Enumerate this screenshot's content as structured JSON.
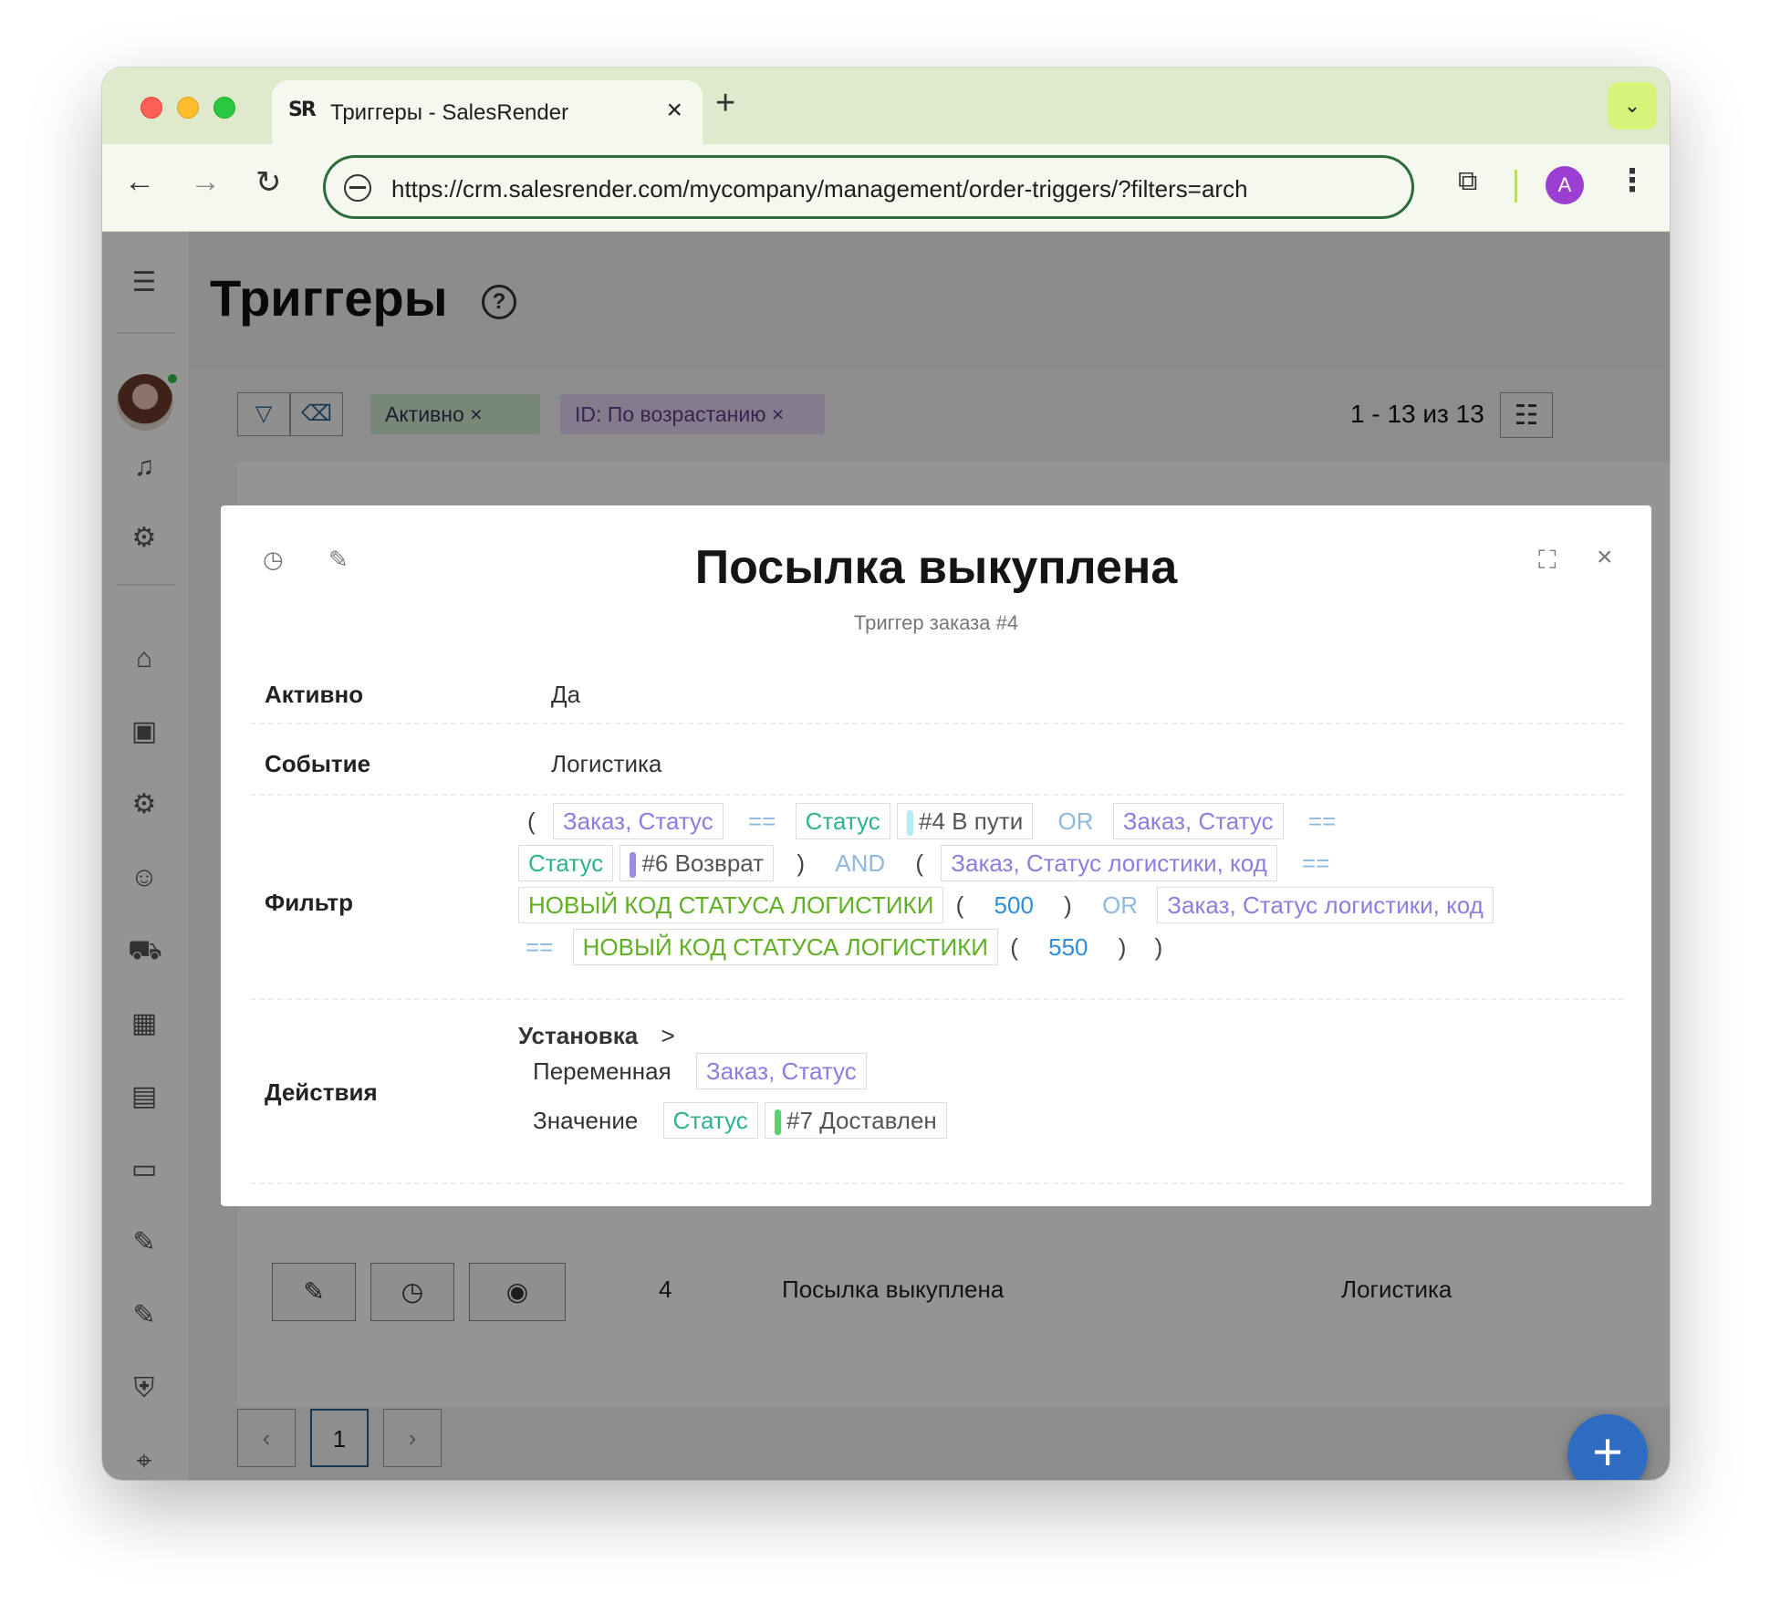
{
  "browser": {
    "tab_title": "Триггеры - SalesRender",
    "tab_logo": "SR",
    "url": "https://crm.salesrender.com/mycompany/management/order-triggers/?filters=arch",
    "avatar_letter": "A"
  },
  "page": {
    "title": "Триггеры",
    "filter_chips": [
      "Активно ×",
      "ID: По возрастанию ×"
    ],
    "count": "1 - 13 из 13",
    "row": {
      "id": "4",
      "name": "Посылка выкуплена",
      "event": "Логистика"
    },
    "pagination": {
      "current": "1"
    }
  },
  "modal": {
    "title": "Посылка выкуплена",
    "subtitle": "Триггер заказа #4",
    "active_label": "Активно",
    "active_value": "Да",
    "event_label": "Событие",
    "event_value": "Логистика",
    "filter_label": "Фильтр",
    "filter": {
      "line1": {
        "p1": "(",
        "t1": "Заказ, Статус",
        "op1": "==",
        "t2": "Статус",
        "t2b": "#4 В пути",
        "op2": "OR",
        "t3": "Заказ, Статус",
        "op3": "=="
      },
      "line2": {
        "t1": "Статус",
        "t1b": "#6 Возврат",
        "p1": ")",
        "op1": "AND",
        "p2": "(",
        "t2": "Заказ, Статус логистики, код",
        "op2": "=="
      },
      "line3": {
        "t1": "НОВЫЙ КОД СТАТУСА ЛОГИСТИКИ",
        "p1": "(",
        "n1": "500",
        "p2": ")",
        "op1": "OR",
        "t2": "Заказ, Статус логистики, код"
      },
      "line4": {
        "op1": "==",
        "t1": "НОВЫЙ КОД СТАТУСА ЛОГИСТИКИ",
        "p1": "(",
        "n1": "550",
        "p2": ")",
        "p3": ")"
      }
    },
    "actions_label": "Действия",
    "action": {
      "type": "Установка",
      "variable_label": "Переменная",
      "variable_value": "Заказ, Статус",
      "value_label": "Значение",
      "value_token": "Статус",
      "value_item": "#7 Доставлен"
    }
  },
  "colors": {
    "status_in_transit": "#b3ecf5",
    "status_return": "#9b8ae6",
    "status_delivered": "#59d36b",
    "fab": "#2d6cc0"
  }
}
